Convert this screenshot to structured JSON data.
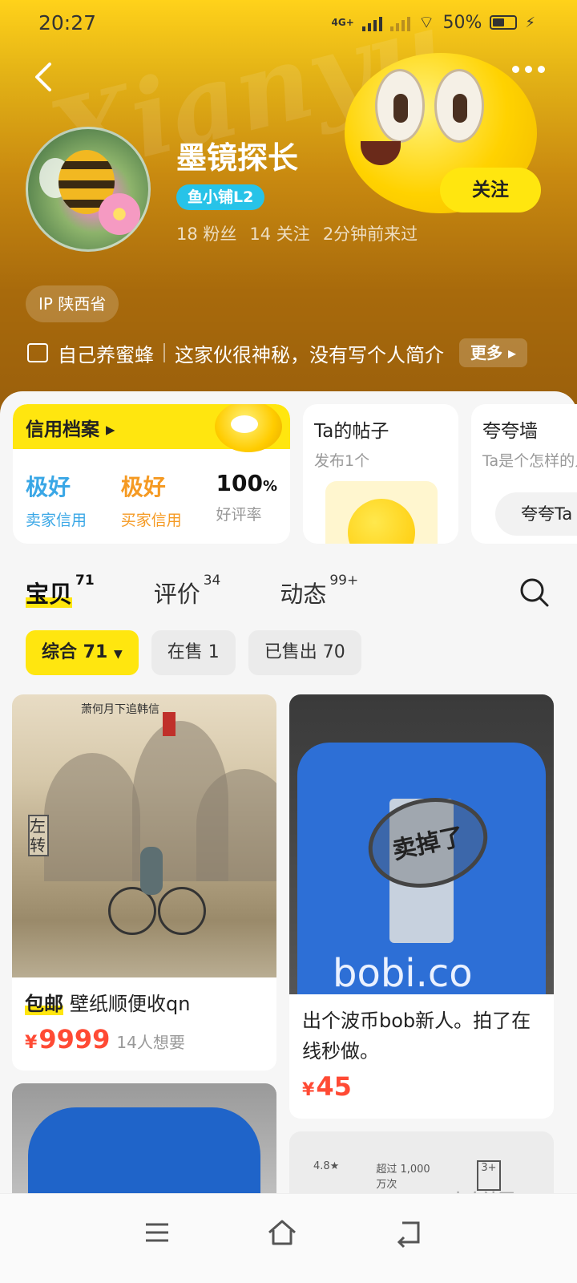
{
  "status_bar": {
    "time": "20:27",
    "network": "4G+",
    "battery": "50%"
  },
  "profile": {
    "name": "墨镜探长",
    "level": "鱼小铺L2",
    "fans": "18 粉丝",
    "following": "14 关注",
    "last_seen": "2分钟前来过",
    "follow_label": "关注",
    "ip": "IP 陕西省",
    "bio_title": "自己养蜜蜂",
    "bio_desc": "这家伙很神秘，没有写个人简介",
    "more_label": "更多"
  },
  "credit": {
    "title": "信用档案",
    "seller": {
      "value": "极好",
      "label": "卖家信用"
    },
    "buyer": {
      "value": "极好",
      "label": "买家信用"
    },
    "rate": {
      "value": "100",
      "unit": "%",
      "label": "好评率"
    }
  },
  "posts": {
    "title": "Ta的帖子",
    "sub": "发布1个"
  },
  "praise": {
    "title": "夸夸墙",
    "sub": "Ta是个怎样的人",
    "pill": "夸夸Ta"
  },
  "tabs": [
    {
      "label": "宝贝",
      "count": "71"
    },
    {
      "label": "评价",
      "count": "34"
    },
    {
      "label": "动态",
      "count": "99+"
    }
  ],
  "filters": [
    {
      "label": "综合 71"
    },
    {
      "label": "在售 1"
    },
    {
      "label": "已售出 70"
    }
  ],
  "products": [
    {
      "tag": "包邮",
      "title": "壁纸顺便收qn",
      "currency": "¥",
      "price": "9999",
      "wants": "14人想要",
      "image_caption": "萧何月下追韩信",
      "sign_text": "左转"
    },
    {
      "title": "出个波币bob新人。拍了在线秒做。",
      "currency": "¥",
      "price": "45",
      "stamp": "卖掉了",
      "image_brand": "bobi.co"
    }
  ],
  "partial_card": {
    "rating": "4.8★",
    "downloads": "超过 1,000万次",
    "age": "3+"
  },
  "watermark": "卡农社区",
  "colors": {
    "accent": "#ffe60f",
    "price": "#ff4a34",
    "seller_credit": "#3aa7e6",
    "buyer_credit": "#f59a23",
    "level_badge": "#27c3e8"
  }
}
